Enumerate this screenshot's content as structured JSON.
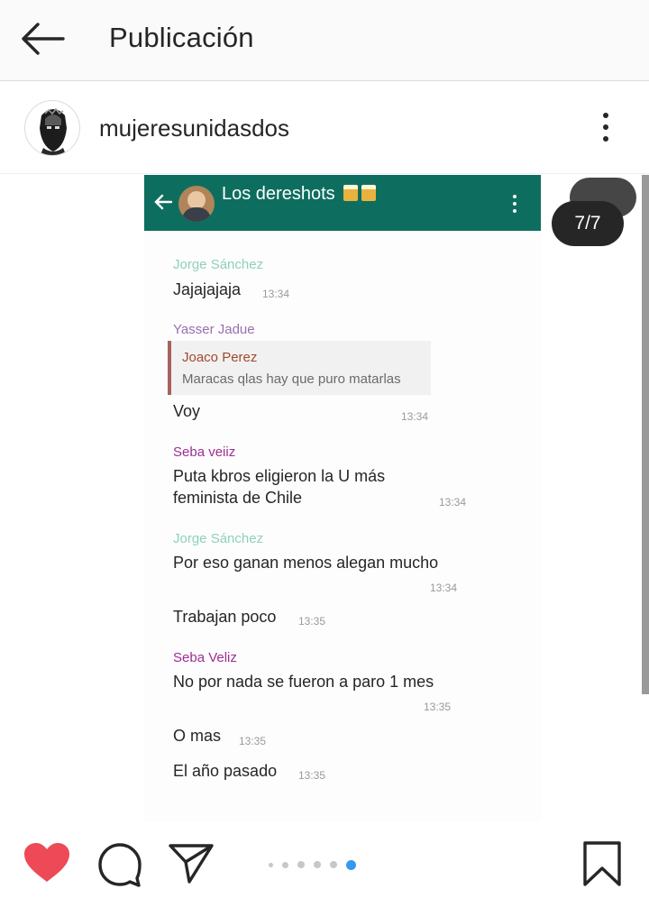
{
  "topbar": {
    "title": "Publicación"
  },
  "post": {
    "username": "mujeresunidasdos",
    "counter": "7/7",
    "carousel_total": 6,
    "carousel_active": 6
  },
  "chat": {
    "group_title": "Los dereshots",
    "messages": [
      {
        "sender": "Jorge Sánchez",
        "sender_color": "#8fd1b6",
        "text": "Jajajajaja",
        "time": "13:34"
      },
      {
        "sender": "Yasser Jadue",
        "sender_color": "#9a6fb0",
        "quote_sender": "Joaco Perez",
        "quote_text": "Maracas qlas hay que puro matarlas",
        "text": "Voy",
        "time": "13:34"
      },
      {
        "sender": "Seba veiiz",
        "sender_color": "#9b2f93",
        "text_line1": "Puta kbros eligieron la U más",
        "text_line2": "feminista de Chile",
        "time": "13:34"
      },
      {
        "sender": "Jorge Sánchez",
        "sender_color": "#8fd1b6",
        "text": "Por eso ganan menos alegan mucho",
        "time": "13:34"
      },
      {
        "text": "Trabajan poco",
        "time": "13:35"
      },
      {
        "sender": "Seba Veliz",
        "sender_color": "#9b2f93",
        "text": "No por nada se fueron a paro 1 mes",
        "time": "13:35"
      },
      {
        "text": "O mas",
        "time": "13:35"
      },
      {
        "text": "El año pasado",
        "time": "13:35"
      }
    ]
  },
  "icons": {
    "back": "arrow-left-icon",
    "more": "more-vertical-icon",
    "like": "heart-icon",
    "comment": "comment-icon",
    "share": "send-icon",
    "save": "bookmark-icon"
  },
  "colors": {
    "like_red": "#ed4956",
    "dot_active": "#3897f0",
    "dot_inactive": "#c7c7c7",
    "whatsapp_header": "#0d6e5f"
  }
}
